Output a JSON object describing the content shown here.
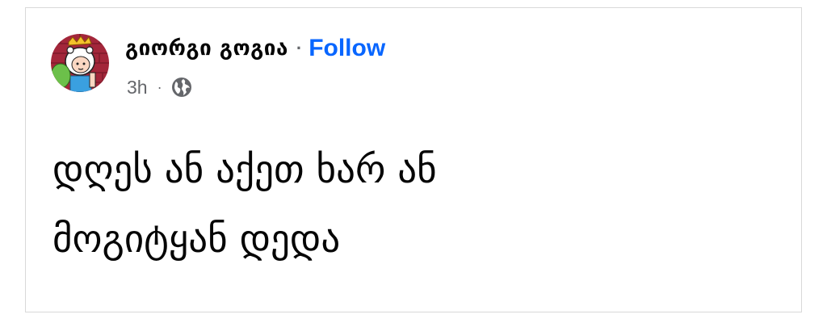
{
  "post": {
    "author_name": "გიორგი გოგია",
    "separator": "·",
    "follow_label": "Follow",
    "time": "3h",
    "meta_separator": "·",
    "audience_icon": "globe-icon",
    "text_lines": [
      "დღეს ან აქეთ ხარ ან",
      "მოგიტყან დედა"
    ]
  },
  "colors": {
    "name": "#050505",
    "follow": "#0866ff",
    "meta": "#65676b",
    "border": "#d9d9d9"
  }
}
